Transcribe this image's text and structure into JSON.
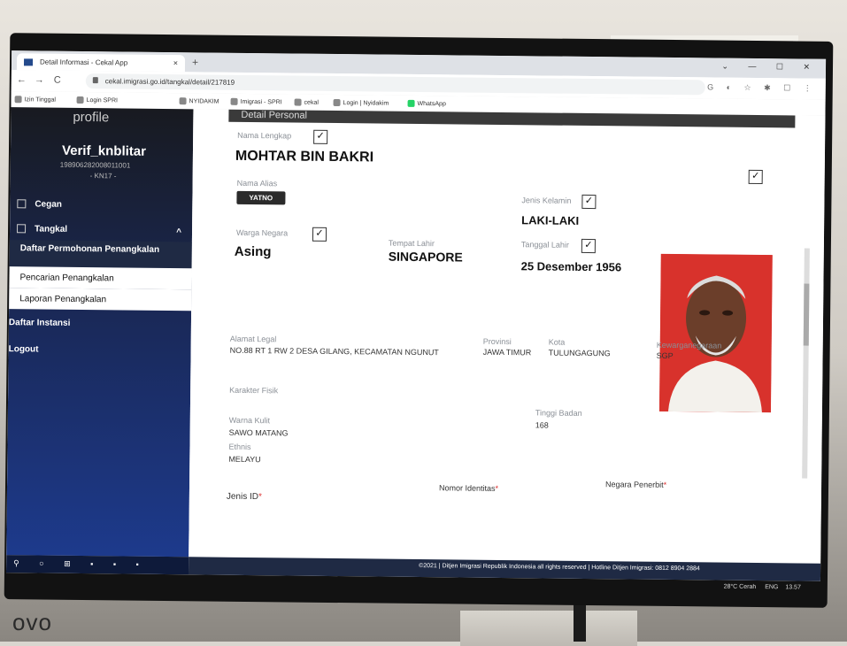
{
  "browser": {
    "tab_title": "Detail Informasi - Cekal App",
    "tab_close": "×",
    "new_tab": "+",
    "url": "cekal.imigrasi.go.id/tangkal/detail/217819",
    "window_controls": "⌄ — ☐ ✕",
    "bookmarks": [
      "Izin Tinggal",
      "Login SPRI",
      "NYIDAKIM",
      "Imigrasi - SPRI",
      "cekal",
      "Login | Nyidakim",
      "WhatsApp"
    ]
  },
  "sidebar": {
    "heading": "profile",
    "username": "Verif_knblitar",
    "nip": "198906282008011001",
    "unit": "- KN17 -",
    "menu": [
      {
        "label": "Cegan"
      },
      {
        "label": "Tangkal",
        "chevron": "^"
      }
    ],
    "submenu": [
      {
        "label": "Daftar Permohonan Penangkalan"
      },
      {
        "label": "Pencarian Penangkalan"
      },
      {
        "label": "Laporan Penangkalan"
      }
    ],
    "daftar_instansi": "Daftar Instansi",
    "logout": "Logout"
  },
  "detail": {
    "section_title": "Detail Personal",
    "nama_lengkap_label": "Nama Lengkap",
    "nama_lengkap": "MOHTAR BIN BAKRI",
    "nama_alias_label": "Nama Alias",
    "nama_alias": "YATNO",
    "jenis_kelamin_label": "Jenis Kelamin",
    "jenis_kelamin": "LAKI-LAKI",
    "warga_negara_label": "Warga Negara",
    "warga_negara": "Asing",
    "tempat_lahir_label": "Tempat Lahir",
    "tempat_lahir": "SINGAPORE",
    "tanggal_lahir_label": "Tanggal Lahir",
    "tanggal_lahir": "25 Desember 1956",
    "alamat_label": "Alamat Legal",
    "alamat": "NO.88 RT 1 RW 2 DESA GILANG, KECAMATAN NGUNUT",
    "provinsi_label": "Provinsi",
    "provinsi": "JAWA TIMUR",
    "kota_label": "Kota",
    "kota": "TULUNGAGUNG",
    "kewarganegaraan_label": "Kewarganegaraan",
    "kewarganegaraan": "SGP",
    "karakter_fisik_label": "Karakter Fisik",
    "warna_kulit_label": "Warna Kulit",
    "warna_kulit": "SAWO MATANG",
    "tinggi_badan_label": "Tinggi Badan",
    "tinggi_badan": "168",
    "ethnis_label": "Ethnis",
    "ethnis": "MELAYU",
    "jenis_id_label": "Jenis ID",
    "nomor_identitas_label": "Nomor Identitas",
    "negara_penerbit_label": "Negara Penerbit",
    "required_mark": "*"
  },
  "footer": {
    "text": "©2021 | Ditjen Imigrasi Republik Indonesia all rights reserved | Hotline Ditjen Imigrasi: 0812 8904 2884"
  },
  "taskbar": {
    "weather": "28°C Cerah",
    "language": "ENG",
    "time": "13.57"
  },
  "monitor_brand": "ovo",
  "colors": {
    "sidebar_top": "#181a20",
    "sidebar_bottom": "#1d3a8c",
    "photo_bg": "#d8322c",
    "footer_bg": "#1f2a44"
  }
}
